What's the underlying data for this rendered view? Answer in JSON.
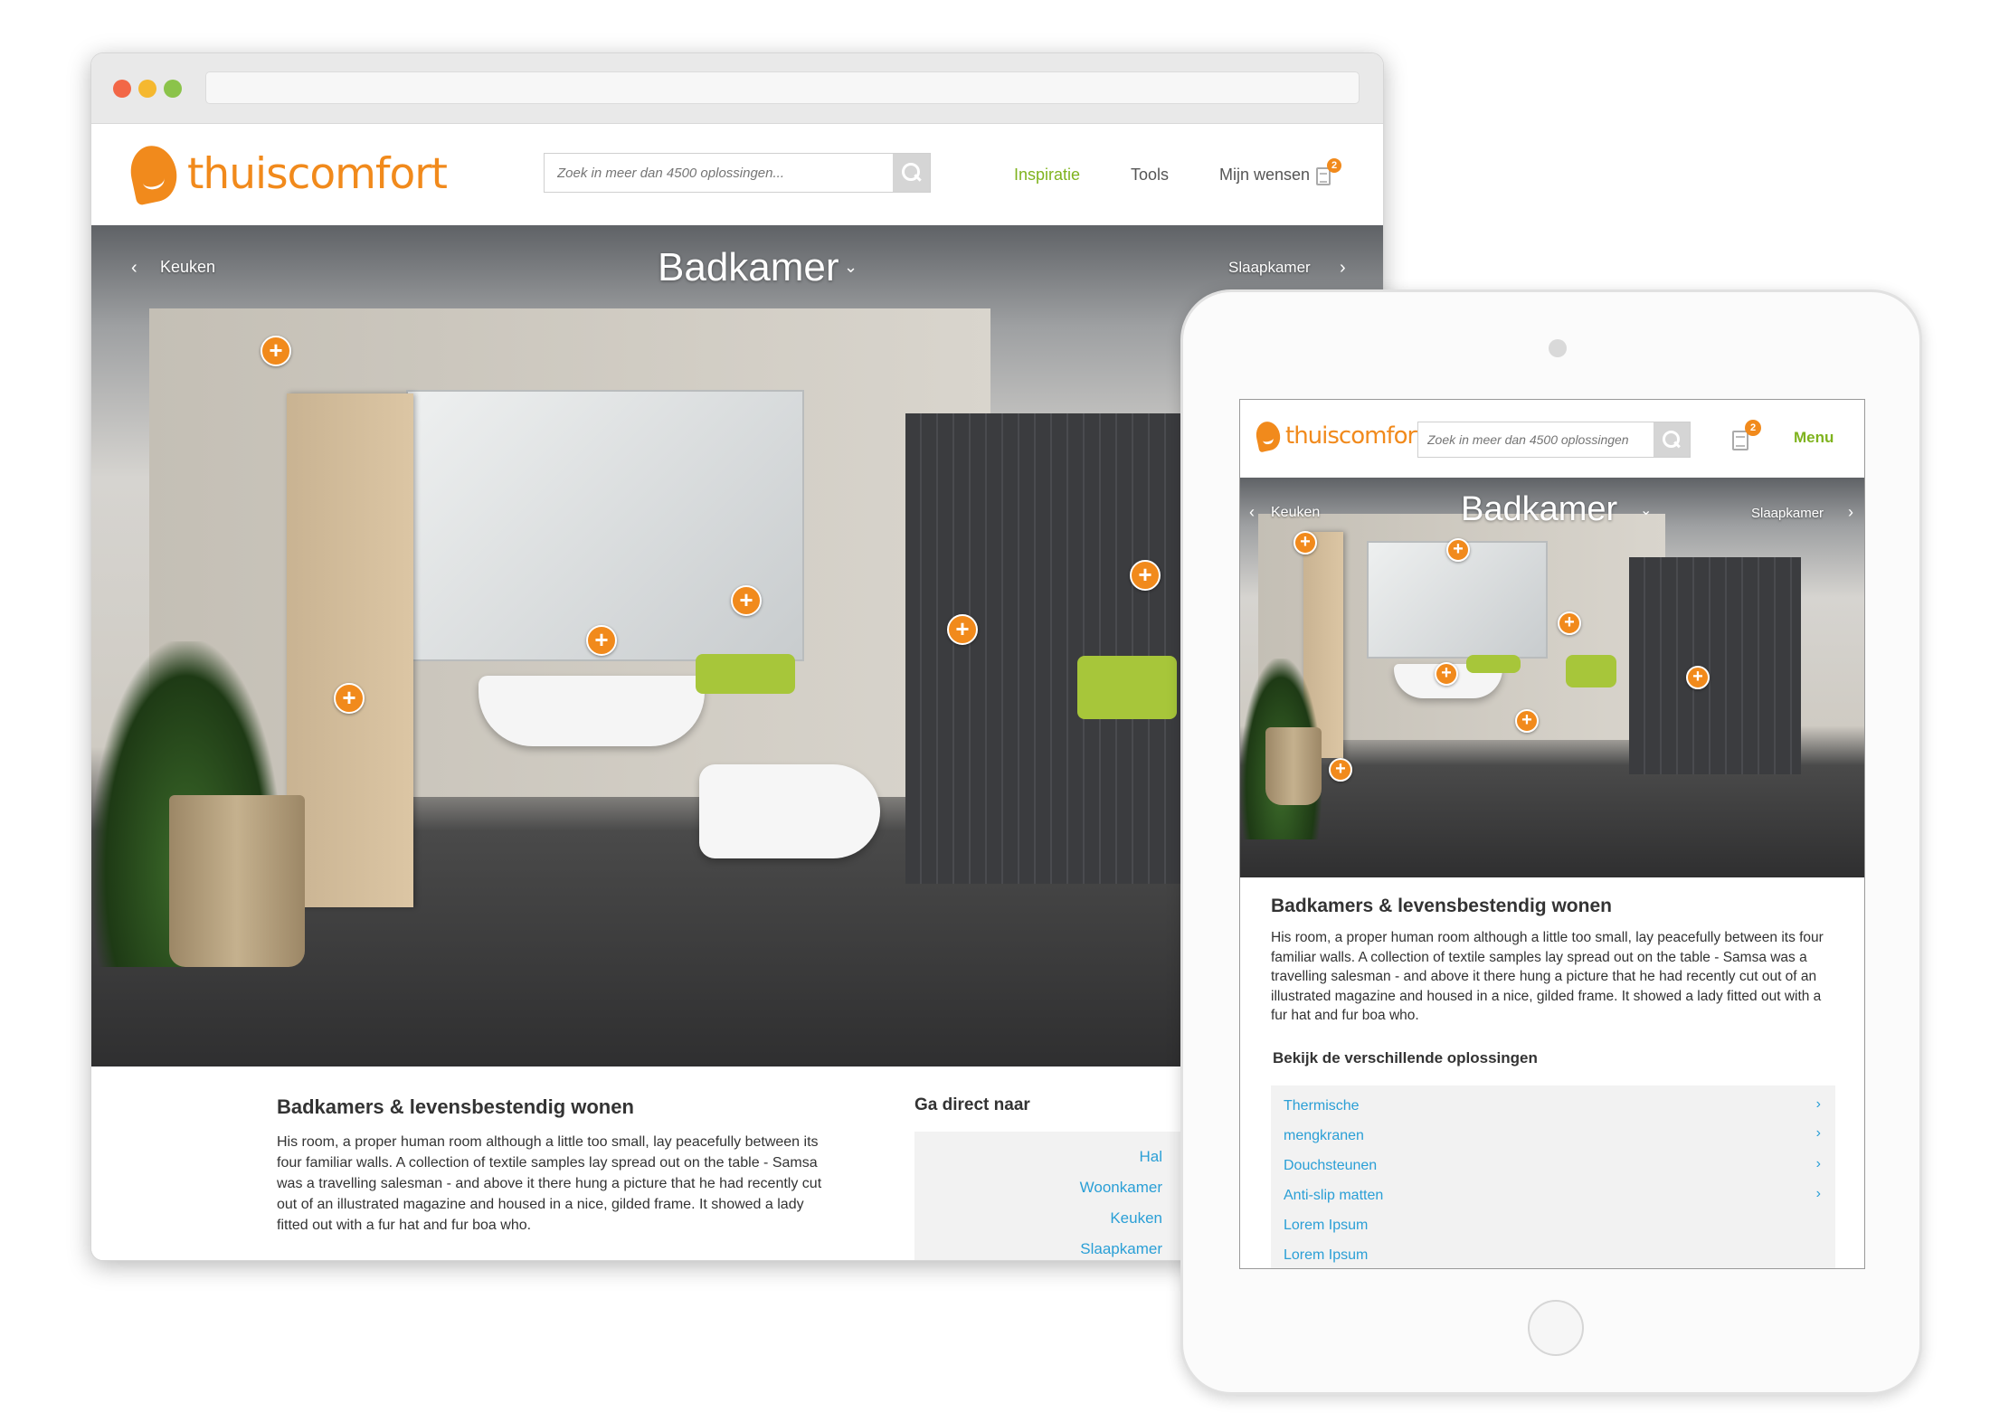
{
  "brand": {
    "name": "thuiscomfort",
    "accent": "#f18a1c",
    "nav_active_color": "#7fb31e",
    "link_color": "#2a9fd6"
  },
  "search": {
    "placeholder_desktop": "Zoek in meer dan 4500 oplossingen...",
    "placeholder_tablet": "Zoek in meer dan 4500 oplossingen"
  },
  "nav": {
    "items": [
      {
        "label": "Inspiratie",
        "active": true
      },
      {
        "label": "Tools"
      },
      {
        "label": "Mijn wensen"
      }
    ],
    "wishlist_count": "2",
    "menu_label": "Menu"
  },
  "hero": {
    "title": "Badkamer",
    "prev_label": "Keuken",
    "next_label": "Slaapkamer",
    "dropdown_icon": "chevron-down-icon",
    "hotspot_glyph": "+"
  },
  "content": {
    "title": "Badkamers & levensbestendig wonen",
    "paragraph_desktop": "His room, a proper human room although a little too small, lay peacefully between its four familiar walls. A collection of textile samples lay spread out on the table - Samsa was a travelling salesman - and above it there hung a picture that he had recently cut out of an illustrated magazine and housed in a nice, gilded frame. It showed a lady fitted out with a fur hat and fur boa who.",
    "paragraph_tablet": "His room, a proper human room although a little too small, lay peacefully between its four familiar walls. A collection of textile samples lay spread out on the table - Samsa was a travelling salesman - and above it there hung a picture that he had recently cut out of an illustrated magazine and housed in a nice, gilded frame. It showed a lady fitted out with a fur hat and fur boa who.",
    "side_title": "Ga direct naar",
    "side_links": [
      "Hal",
      "Woonkamer",
      "Keuken",
      "Slaapkamer"
    ],
    "solutions_title": "Bekijk de verschillende oplossingen",
    "solutions": [
      "Thermische",
      "mengkranen",
      "Douchsteunen",
      "Anti-slip matten",
      "Lorem Ipsum",
      "Lorem Ipsum"
    ]
  }
}
